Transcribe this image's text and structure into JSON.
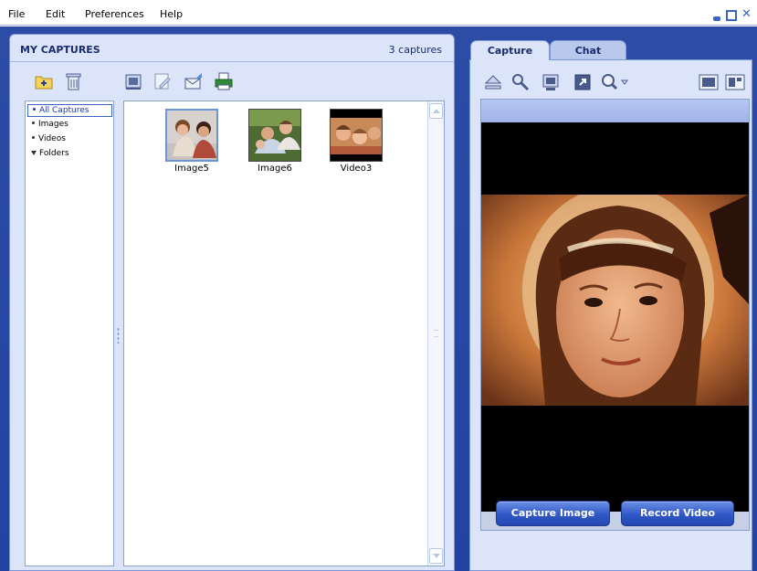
{
  "menu": {
    "file": "File",
    "edit": "Edit",
    "preferences": "Preferences",
    "help": "Help"
  },
  "captures": {
    "title": "MY CAPTURES",
    "count": "3 captures",
    "tree": [
      "All Captures",
      "Images",
      "Videos",
      "Folders"
    ],
    "thumbnails": [
      {
        "label": "Image5"
      },
      {
        "label": "Image6"
      },
      {
        "label": "Video3"
      }
    ]
  },
  "tabs": {
    "capture": "Capture",
    "chat": "Chat"
  },
  "buttons": {
    "capture_image": "Capture Image",
    "record_video": "Record Video"
  },
  "colors": {
    "accent": "#2243a0",
    "panel": "#dbe4f9",
    "button": "#3158c8"
  },
  "icons": {
    "left_toolbar": [
      "new-folder-icon",
      "delete-icon",
      "slideshow-icon",
      "edit-icon",
      "email-icon",
      "print-icon"
    ],
    "right_toolbar": [
      "eject-icon",
      "settings-icon",
      "snapshot-icon",
      "fullscreen-icon",
      "zoom-icon",
      "single-view-icon",
      "split-view-icon"
    ]
  }
}
